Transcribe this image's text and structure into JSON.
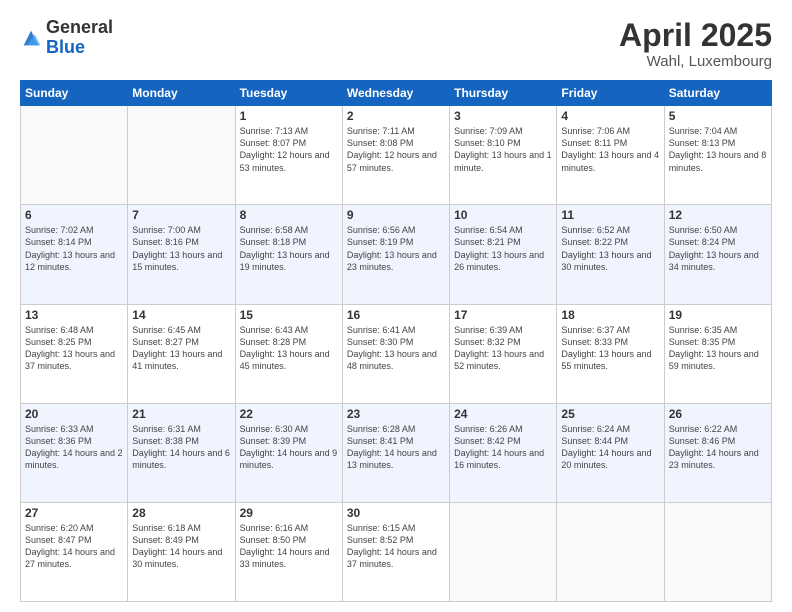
{
  "header": {
    "logo_general": "General",
    "logo_blue": "Blue",
    "main_title": "April 2025",
    "subtitle": "Wahl, Luxembourg"
  },
  "days_of_week": [
    "Sunday",
    "Monday",
    "Tuesday",
    "Wednesday",
    "Thursday",
    "Friday",
    "Saturday"
  ],
  "weeks": [
    [
      {
        "day": "",
        "sunrise": "",
        "sunset": "",
        "daylight": "",
        "empty": true
      },
      {
        "day": "",
        "sunrise": "",
        "sunset": "",
        "daylight": "",
        "empty": true
      },
      {
        "day": "1",
        "sunrise": "Sunrise: 7:13 AM",
        "sunset": "Sunset: 8:07 PM",
        "daylight": "Daylight: 12 hours and 53 minutes.",
        "empty": false
      },
      {
        "day": "2",
        "sunrise": "Sunrise: 7:11 AM",
        "sunset": "Sunset: 8:08 PM",
        "daylight": "Daylight: 12 hours and 57 minutes.",
        "empty": false
      },
      {
        "day": "3",
        "sunrise": "Sunrise: 7:09 AM",
        "sunset": "Sunset: 8:10 PM",
        "daylight": "Daylight: 13 hours and 1 minute.",
        "empty": false
      },
      {
        "day": "4",
        "sunrise": "Sunrise: 7:06 AM",
        "sunset": "Sunset: 8:11 PM",
        "daylight": "Daylight: 13 hours and 4 minutes.",
        "empty": false
      },
      {
        "day": "5",
        "sunrise": "Sunrise: 7:04 AM",
        "sunset": "Sunset: 8:13 PM",
        "daylight": "Daylight: 13 hours and 8 minutes.",
        "empty": false
      }
    ],
    [
      {
        "day": "6",
        "sunrise": "Sunrise: 7:02 AM",
        "sunset": "Sunset: 8:14 PM",
        "daylight": "Daylight: 13 hours and 12 minutes.",
        "empty": false
      },
      {
        "day": "7",
        "sunrise": "Sunrise: 7:00 AM",
        "sunset": "Sunset: 8:16 PM",
        "daylight": "Daylight: 13 hours and 15 minutes.",
        "empty": false
      },
      {
        "day": "8",
        "sunrise": "Sunrise: 6:58 AM",
        "sunset": "Sunset: 8:18 PM",
        "daylight": "Daylight: 13 hours and 19 minutes.",
        "empty": false
      },
      {
        "day": "9",
        "sunrise": "Sunrise: 6:56 AM",
        "sunset": "Sunset: 8:19 PM",
        "daylight": "Daylight: 13 hours and 23 minutes.",
        "empty": false
      },
      {
        "day": "10",
        "sunrise": "Sunrise: 6:54 AM",
        "sunset": "Sunset: 8:21 PM",
        "daylight": "Daylight: 13 hours and 26 minutes.",
        "empty": false
      },
      {
        "day": "11",
        "sunrise": "Sunrise: 6:52 AM",
        "sunset": "Sunset: 8:22 PM",
        "daylight": "Daylight: 13 hours and 30 minutes.",
        "empty": false
      },
      {
        "day": "12",
        "sunrise": "Sunrise: 6:50 AM",
        "sunset": "Sunset: 8:24 PM",
        "daylight": "Daylight: 13 hours and 34 minutes.",
        "empty": false
      }
    ],
    [
      {
        "day": "13",
        "sunrise": "Sunrise: 6:48 AM",
        "sunset": "Sunset: 8:25 PM",
        "daylight": "Daylight: 13 hours and 37 minutes.",
        "empty": false
      },
      {
        "day": "14",
        "sunrise": "Sunrise: 6:45 AM",
        "sunset": "Sunset: 8:27 PM",
        "daylight": "Daylight: 13 hours and 41 minutes.",
        "empty": false
      },
      {
        "day": "15",
        "sunrise": "Sunrise: 6:43 AM",
        "sunset": "Sunset: 8:28 PM",
        "daylight": "Daylight: 13 hours and 45 minutes.",
        "empty": false
      },
      {
        "day": "16",
        "sunrise": "Sunrise: 6:41 AM",
        "sunset": "Sunset: 8:30 PM",
        "daylight": "Daylight: 13 hours and 48 minutes.",
        "empty": false
      },
      {
        "day": "17",
        "sunrise": "Sunrise: 6:39 AM",
        "sunset": "Sunset: 8:32 PM",
        "daylight": "Daylight: 13 hours and 52 minutes.",
        "empty": false
      },
      {
        "day": "18",
        "sunrise": "Sunrise: 6:37 AM",
        "sunset": "Sunset: 8:33 PM",
        "daylight": "Daylight: 13 hours and 55 minutes.",
        "empty": false
      },
      {
        "day": "19",
        "sunrise": "Sunrise: 6:35 AM",
        "sunset": "Sunset: 8:35 PM",
        "daylight": "Daylight: 13 hours and 59 minutes.",
        "empty": false
      }
    ],
    [
      {
        "day": "20",
        "sunrise": "Sunrise: 6:33 AM",
        "sunset": "Sunset: 8:36 PM",
        "daylight": "Daylight: 14 hours and 2 minutes.",
        "empty": false
      },
      {
        "day": "21",
        "sunrise": "Sunrise: 6:31 AM",
        "sunset": "Sunset: 8:38 PM",
        "daylight": "Daylight: 14 hours and 6 minutes.",
        "empty": false
      },
      {
        "day": "22",
        "sunrise": "Sunrise: 6:30 AM",
        "sunset": "Sunset: 8:39 PM",
        "daylight": "Daylight: 14 hours and 9 minutes.",
        "empty": false
      },
      {
        "day": "23",
        "sunrise": "Sunrise: 6:28 AM",
        "sunset": "Sunset: 8:41 PM",
        "daylight": "Daylight: 14 hours and 13 minutes.",
        "empty": false
      },
      {
        "day": "24",
        "sunrise": "Sunrise: 6:26 AM",
        "sunset": "Sunset: 8:42 PM",
        "daylight": "Daylight: 14 hours and 16 minutes.",
        "empty": false
      },
      {
        "day": "25",
        "sunrise": "Sunrise: 6:24 AM",
        "sunset": "Sunset: 8:44 PM",
        "daylight": "Daylight: 14 hours and 20 minutes.",
        "empty": false
      },
      {
        "day": "26",
        "sunrise": "Sunrise: 6:22 AM",
        "sunset": "Sunset: 8:46 PM",
        "daylight": "Daylight: 14 hours and 23 minutes.",
        "empty": false
      }
    ],
    [
      {
        "day": "27",
        "sunrise": "Sunrise: 6:20 AM",
        "sunset": "Sunset: 8:47 PM",
        "daylight": "Daylight: 14 hours and 27 minutes.",
        "empty": false
      },
      {
        "day": "28",
        "sunrise": "Sunrise: 6:18 AM",
        "sunset": "Sunset: 8:49 PM",
        "daylight": "Daylight: 14 hours and 30 minutes.",
        "empty": false
      },
      {
        "day": "29",
        "sunrise": "Sunrise: 6:16 AM",
        "sunset": "Sunset: 8:50 PM",
        "daylight": "Daylight: 14 hours and 33 minutes.",
        "empty": false
      },
      {
        "day": "30",
        "sunrise": "Sunrise: 6:15 AM",
        "sunset": "Sunset: 8:52 PM",
        "daylight": "Daylight: 14 hours and 37 minutes.",
        "empty": false
      },
      {
        "day": "",
        "sunrise": "",
        "sunset": "",
        "daylight": "",
        "empty": true
      },
      {
        "day": "",
        "sunrise": "",
        "sunset": "",
        "daylight": "",
        "empty": true
      },
      {
        "day": "",
        "sunrise": "",
        "sunset": "",
        "daylight": "",
        "empty": true
      }
    ]
  ]
}
